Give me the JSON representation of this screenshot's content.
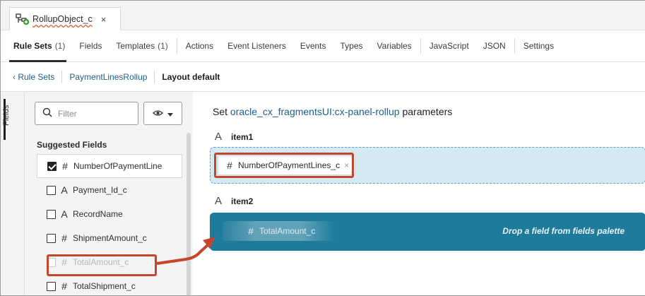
{
  "file_tab": {
    "title": "RollupObject_c",
    "close": "×"
  },
  "tabs": [
    {
      "label": "Rule Sets",
      "count": "(1)",
      "active": true
    },
    {
      "label": "Fields",
      "count": ""
    },
    {
      "label": "Templates",
      "count": "(1)"
    },
    {
      "label": "Actions",
      "count": ""
    },
    {
      "label": "Event Listeners",
      "count": ""
    },
    {
      "label": "Events",
      "count": ""
    },
    {
      "label": "Types",
      "count": ""
    },
    {
      "label": "Variables",
      "count": ""
    },
    {
      "label": "JavaScript",
      "count": ""
    },
    {
      "label": "JSON",
      "count": ""
    },
    {
      "label": "Settings",
      "count": ""
    }
  ],
  "breadcrumb": {
    "back": "‹ Rule Sets",
    "ruleset": "PaymentLinesRollup",
    "current": "Layout default"
  },
  "rail": {
    "label": "Fields"
  },
  "fields_panel": {
    "filter_placeholder": "Filter",
    "section_title": "Suggested Fields",
    "items": [
      {
        "type": "#",
        "name": "NumberOfPaymentLine",
        "checked": true,
        "selected": true
      },
      {
        "type": "A",
        "name": "Payment_Id_c",
        "checked": false
      },
      {
        "type": "A",
        "name": "RecordName",
        "checked": false
      },
      {
        "type": "#",
        "name": "ShipmentAmount_c",
        "checked": false
      },
      {
        "type": "#",
        "name": "TotalAmount_c",
        "checked": false,
        "dragging": true
      },
      {
        "type": "#",
        "name": "TotalShipment_c",
        "checked": false
      }
    ]
  },
  "main": {
    "title_prefix": "Set ",
    "component": "oracle_cx_fragmentsUI:cx-panel-rollup",
    "title_suffix": " parameters",
    "item1": {
      "label": "item1",
      "type": "A",
      "chip_type": "#",
      "chip_label": "NumberOfPaymentLines_c",
      "chip_close": "×"
    },
    "item2": {
      "label": "item2",
      "type": "A",
      "ghost_type": "#",
      "ghost_label": "TotalAmount_c",
      "drop_message": "Drop a field from fields palette"
    }
  },
  "colors": {
    "accent_link": "#1a5f8c",
    "annotation_red": "#c4472b",
    "drop_target_active": "#1e7b9c",
    "drop_target_filled": "#d4e9f1"
  }
}
